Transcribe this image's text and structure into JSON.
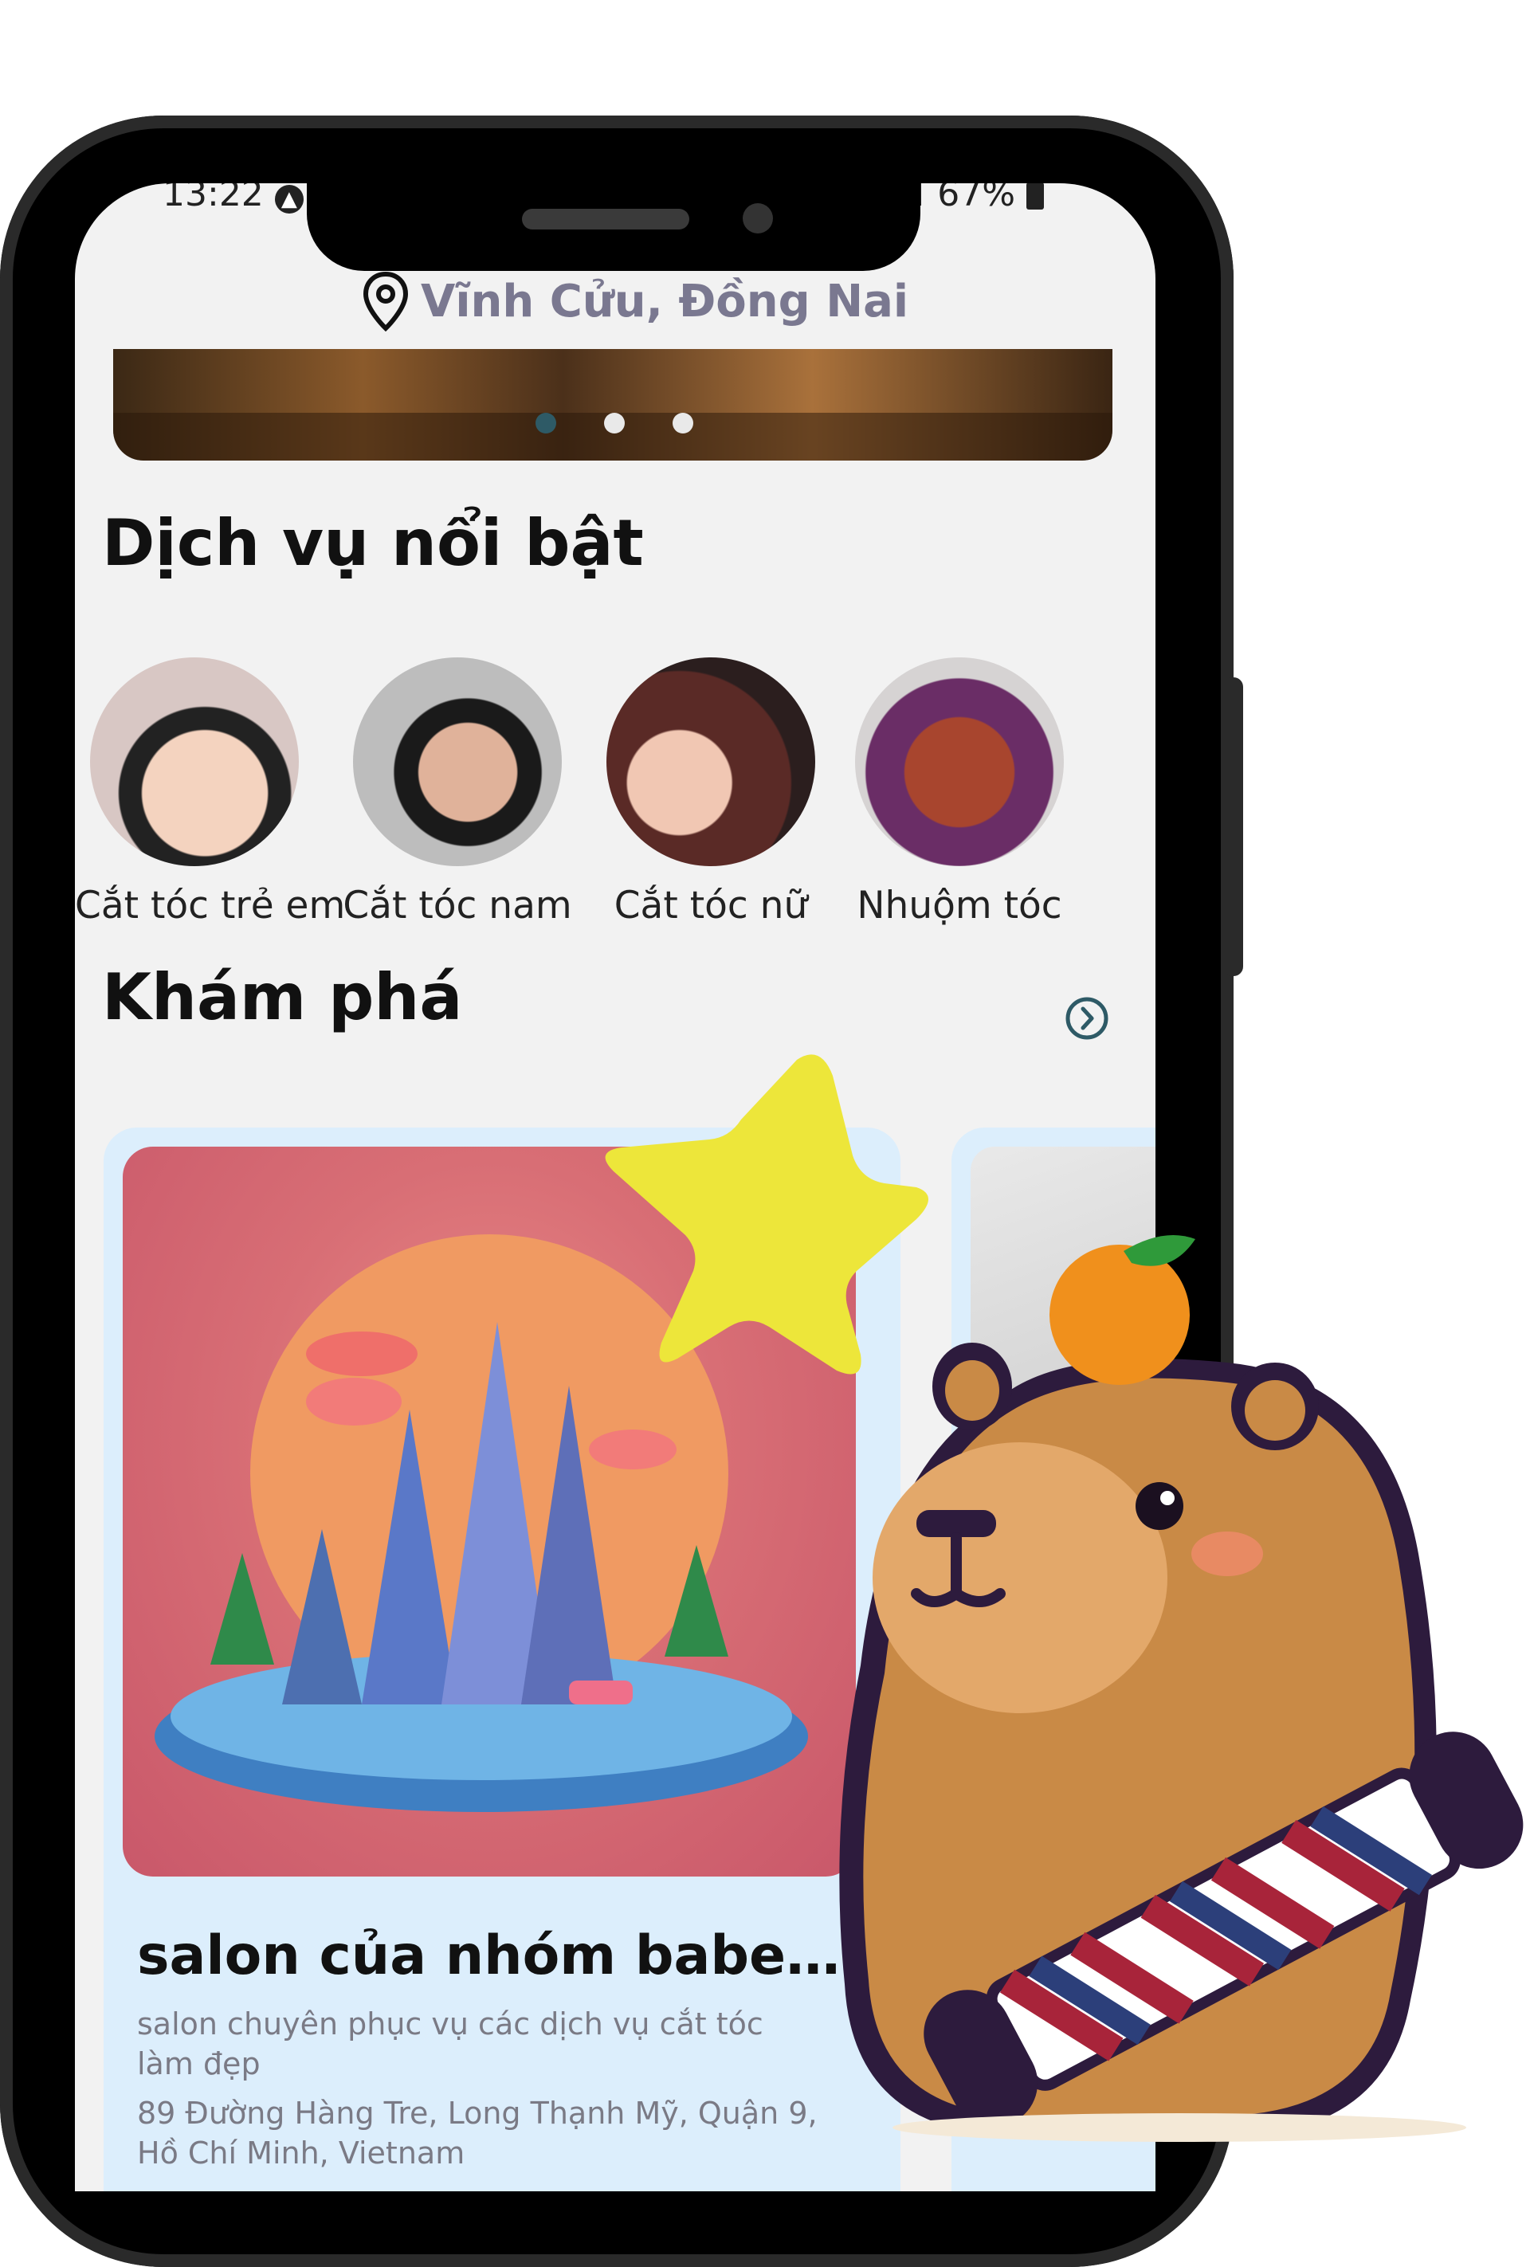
{
  "status_bar": {
    "time": "13:22",
    "battery": "67%"
  },
  "location": {
    "text": "Vĩnh Cửu, Đồng Nai"
  },
  "banner": {
    "dots": 3,
    "active_dot": 0
  },
  "featured": {
    "title": "Dịch vụ nổi bật",
    "items": [
      {
        "label": "Cắt tóc trẻ em"
      },
      {
        "label": "Cắt tóc nam"
      },
      {
        "label": "Cắt tóc nữ"
      },
      {
        "label": "Nhuộm tóc"
      }
    ]
  },
  "explore": {
    "title": "Khám phá",
    "cards": [
      {
        "title": "salon của nhóm baber ...",
        "description": "salon chuyên phục vụ các dịch vụ cắt tóc làm đẹp",
        "address": "89 Đường Hàng Tre, Long Thạnh Mỹ, Quận 9, Hồ Chí Minh, Vietnam"
      }
    ]
  },
  "colors": {
    "accent": "#2e5a66",
    "card_bg": "#dceefc",
    "location_text": "#7a7890"
  }
}
